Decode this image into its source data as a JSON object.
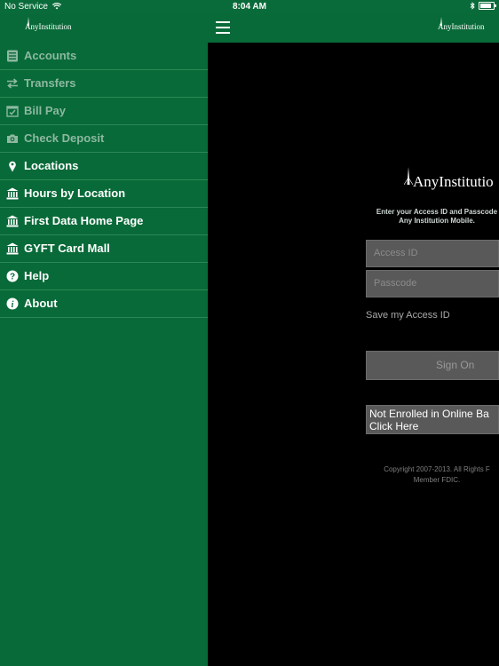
{
  "status_bar": {
    "carrier": "No Service",
    "time": "8:04 AM"
  },
  "top_bar": {
    "logo_left": "AnyInstitution",
    "logo_right": "AnyInstitution"
  },
  "sidebar": {
    "items": [
      {
        "label": "Accounts",
        "icon": "accounts-icon",
        "enabled": false
      },
      {
        "label": "Transfers",
        "icon": "transfer-arrows-icon",
        "enabled": false
      },
      {
        "label": "Bill Pay",
        "icon": "calendar-check-icon",
        "enabled": false
      },
      {
        "label": "Check Deposit",
        "icon": "camera-icon",
        "enabled": false
      },
      {
        "label": "Locations",
        "icon": "location-pin-icon",
        "enabled": true
      },
      {
        "label": "Hours by Location",
        "icon": "bank-icon",
        "enabled": true
      },
      {
        "label": "First Data Home Page",
        "icon": "bank-icon",
        "enabled": true
      },
      {
        "label": "GYFT Card Mall",
        "icon": "bank-icon",
        "enabled": true
      },
      {
        "label": "Help",
        "icon": "help-icon",
        "enabled": true
      },
      {
        "label": "About",
        "icon": "info-icon",
        "enabled": true
      }
    ]
  },
  "login": {
    "logo": "AnyInstitutio",
    "instruction_line1": "Enter your Access ID and Passcode",
    "instruction_line2": "Any Institution Mobile.",
    "access_id_placeholder": "Access ID",
    "passcode_placeholder": "Passcode",
    "save_label": "Save my Access ID",
    "sign_on": "Sign On",
    "enroll_line1": "Not Enrolled in Online Ba",
    "enroll_line2": "Click Here",
    "copyright_line1": "Copyright 2007-2013. All Rights F",
    "copyright_line2": "Member FDIC."
  },
  "colors": {
    "brand_green": "#086a38",
    "background": "#000000"
  }
}
